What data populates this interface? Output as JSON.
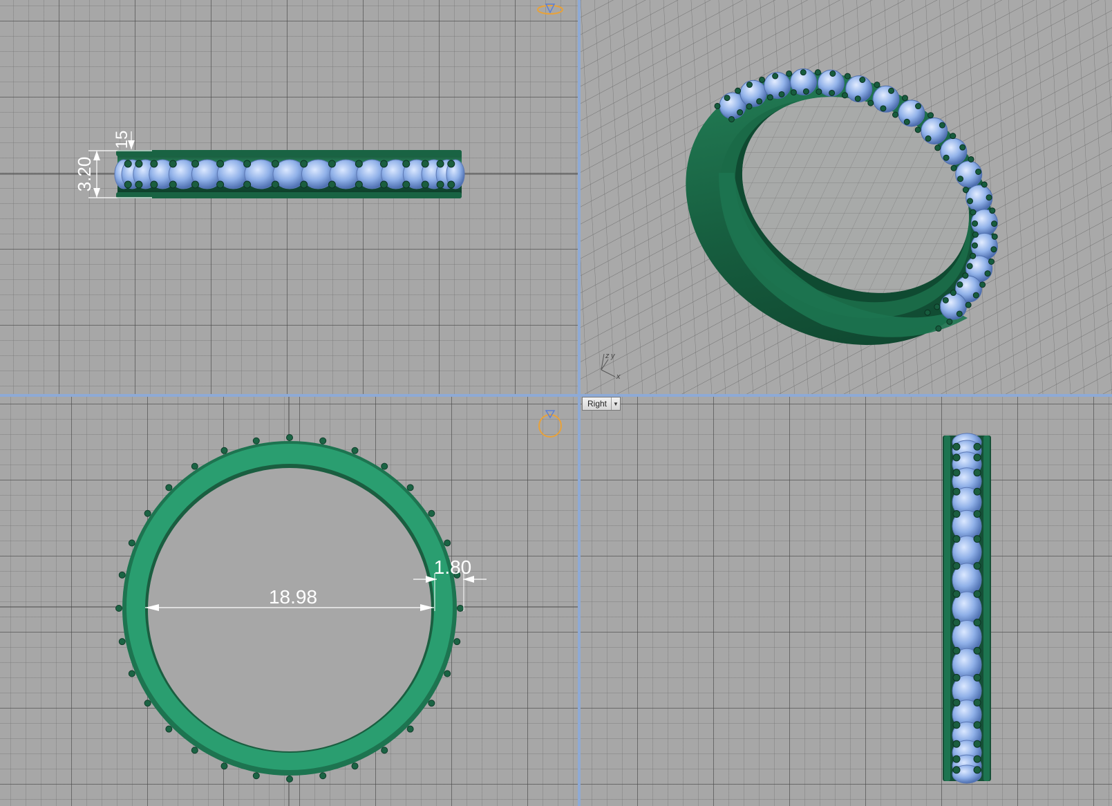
{
  "viewports": {
    "top": {
      "dim_height": "3.20",
      "dim_small": "15"
    },
    "perspective": {
      "axis_z": "z",
      "axis_y": "y",
      "axis_x": "x"
    },
    "front": {
      "dim_inner_diameter": "18.98",
      "dim_band_width": "1.80"
    },
    "right": {
      "label": "Right",
      "dropdown_icon": "chevron-down-icon"
    }
  },
  "colors": {
    "background_grid": "#a7a7a7",
    "band_green": "#1f6e4c",
    "band_face": "#2a9e70",
    "stone_blue": "#8fb0e8",
    "prong_green": "#14563a",
    "separator": "#8eaad6",
    "dimension": "#ffffff",
    "gizmo_orange": "#e8a23a"
  }
}
